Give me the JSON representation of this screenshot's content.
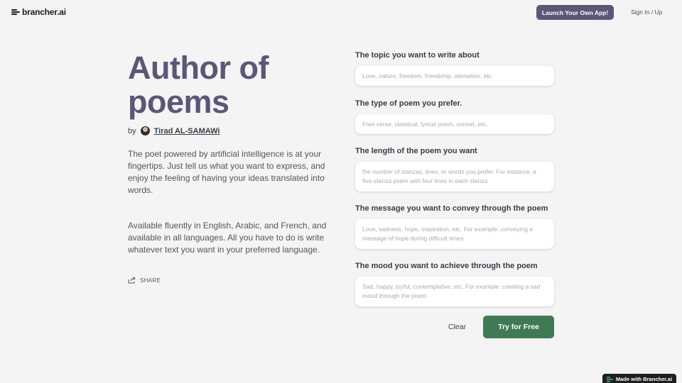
{
  "header": {
    "logo_text": "brancher.ai",
    "launch_label": "Launch Your Own App!",
    "signin_label": "Sign In / Up",
    "accent_color": "#5d5676"
  },
  "app": {
    "title": "Author of poems",
    "by_label": "by",
    "author": "Tirad AL-SAMAWi",
    "description_1": "The poet powered by artificial intelligence is at your fingertips. Just tell us what you want to express, and enjoy the feeling of having your ideas translated into words.",
    "description_2": "Available fluently in English, Arabic, and French, and available in all languages. All you have to do is write whatever text you want in your preferred language.",
    "share_label": "SHARE"
  },
  "form": {
    "fields": [
      {
        "label": "The topic you want to write about",
        "placeholder": "Love, nature, freedom, friendship, alienation, etc."
      },
      {
        "label": "The type of poem you prefer.",
        "placeholder": "Free verse, classical, lyrical poem, sonnet, etc."
      },
      {
        "label": "The length of the poem you want",
        "placeholder": "the number of stanzas, lines, or words you prefer. For instance, a five-stanza poem with four lines in each stanza"
      },
      {
        "label": "The message you want to convey through the poem",
        "placeholder": "Love, sadness, hope, inspiration, etc. For example: conveying a message of hope during difficult times"
      },
      {
        "label": "The mood you want to achieve through the poem",
        "placeholder": "Sad, happy, joyful, contemplative, etc. For example: creating a sad mood through the poem"
      }
    ],
    "clear_label": "Clear",
    "submit_label": "Try for Free",
    "submit_color": "#3f7a55"
  },
  "footer": {
    "made_with_label": "Made with Brancher.ai"
  }
}
